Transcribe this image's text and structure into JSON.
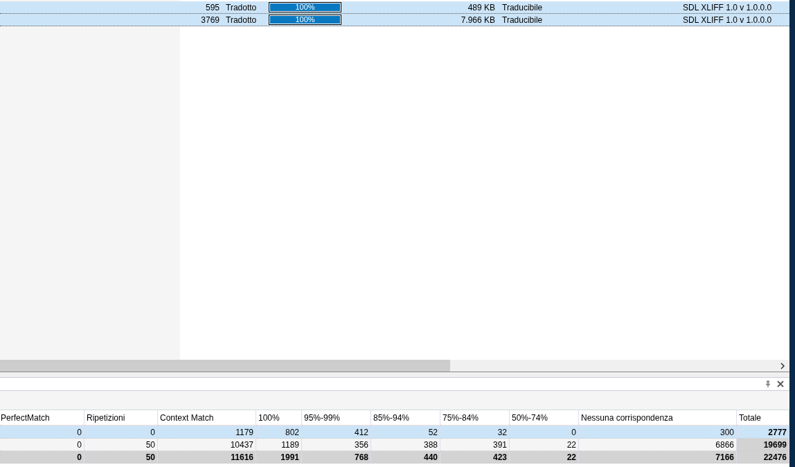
{
  "files": [
    {
      "words": "595",
      "status": "Tradotto",
      "level": 1,
      "progress": "100%",
      "size": "489 KB",
      "kind": "Traducibile",
      "format": "SDL XLIFF 1.0 v 1.0.0.0",
      "selected": true
    },
    {
      "words": "3769",
      "status": "Tradotto",
      "level": 1,
      "progress": "100%",
      "size": "7.966 KB",
      "kind": "Traducibile",
      "format": "SDL XLIFF 1.0 v 1.0.0.0",
      "selected": true
    }
  ],
  "stats": {
    "columns": [
      "PerfectMatch",
      "Ripetizioni",
      "Context Match",
      "100%",
      "95%-99%",
      "85%-94%",
      "75%-84%",
      "50%-74%",
      "Nessuna corrispondenza",
      "Totale"
    ],
    "rows": [
      {
        "selected": true,
        "total": false,
        "cells": [
          "0",
          "0",
          "1179",
          "802",
          "412",
          "52",
          "32",
          "0",
          "300",
          "2777"
        ]
      },
      {
        "selected": false,
        "total": false,
        "cells": [
          "0",
          "50",
          "10437",
          "1189",
          "356",
          "388",
          "391",
          "22",
          "6866",
          "19699"
        ]
      },
      {
        "selected": false,
        "total": true,
        "cells": [
          "0",
          "50",
          "11616",
          "1991",
          "768",
          "440",
          "423",
          "22",
          "7166",
          "22476"
        ]
      }
    ]
  }
}
